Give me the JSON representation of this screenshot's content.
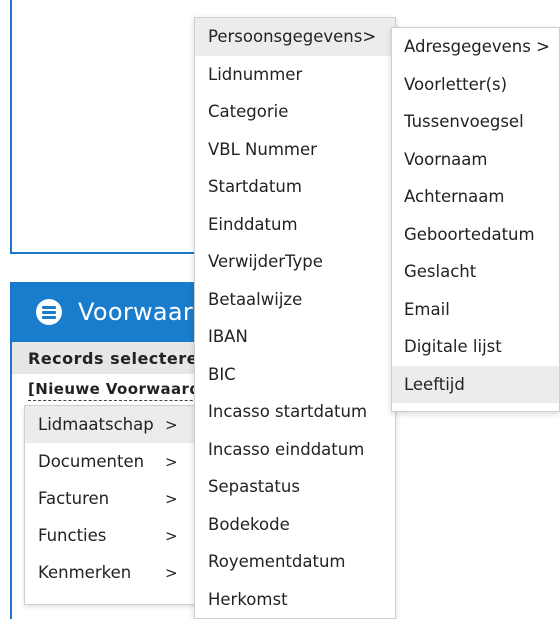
{
  "panel": {
    "title": "Voorwaarden",
    "records_label": "Records selecteren",
    "new_condition": "[Nieuwe Voorwaarde]"
  },
  "category_menu": {
    "items": [
      {
        "label": "Lidmaatschap",
        "arrow": ">"
      },
      {
        "label": "Documenten",
        "arrow": ">"
      },
      {
        "label": "Facturen",
        "arrow": ">"
      },
      {
        "label": "Functies",
        "arrow": ">"
      },
      {
        "label": "Kenmerken",
        "arrow": ">"
      }
    ]
  },
  "field_menu": {
    "items": [
      "Persoonsgegevens>",
      "Lidnummer",
      "Categorie",
      "VBL Nummer",
      "Startdatum",
      "Einddatum",
      "VerwijderType",
      "Betaalwijze",
      "IBAN",
      "BIC",
      "Incasso startdatum",
      "Incasso einddatum",
      "Sepastatus",
      "Bodekode",
      "Royementdatum",
      "Herkomst"
    ]
  },
  "sub_menu": {
    "items": [
      "Adresgegevens >",
      "Voorletter(s)",
      "Tussenvoegsel",
      "Voornaam",
      "Achternaam",
      "Geboortedatum",
      "Geslacht",
      "Email",
      "Digitale lijst",
      "Leeftijd"
    ]
  },
  "colors": {
    "accent": "#1a7ccd",
    "hover": "#ececec"
  },
  "icons": {
    "header": "list-circle-icon"
  }
}
